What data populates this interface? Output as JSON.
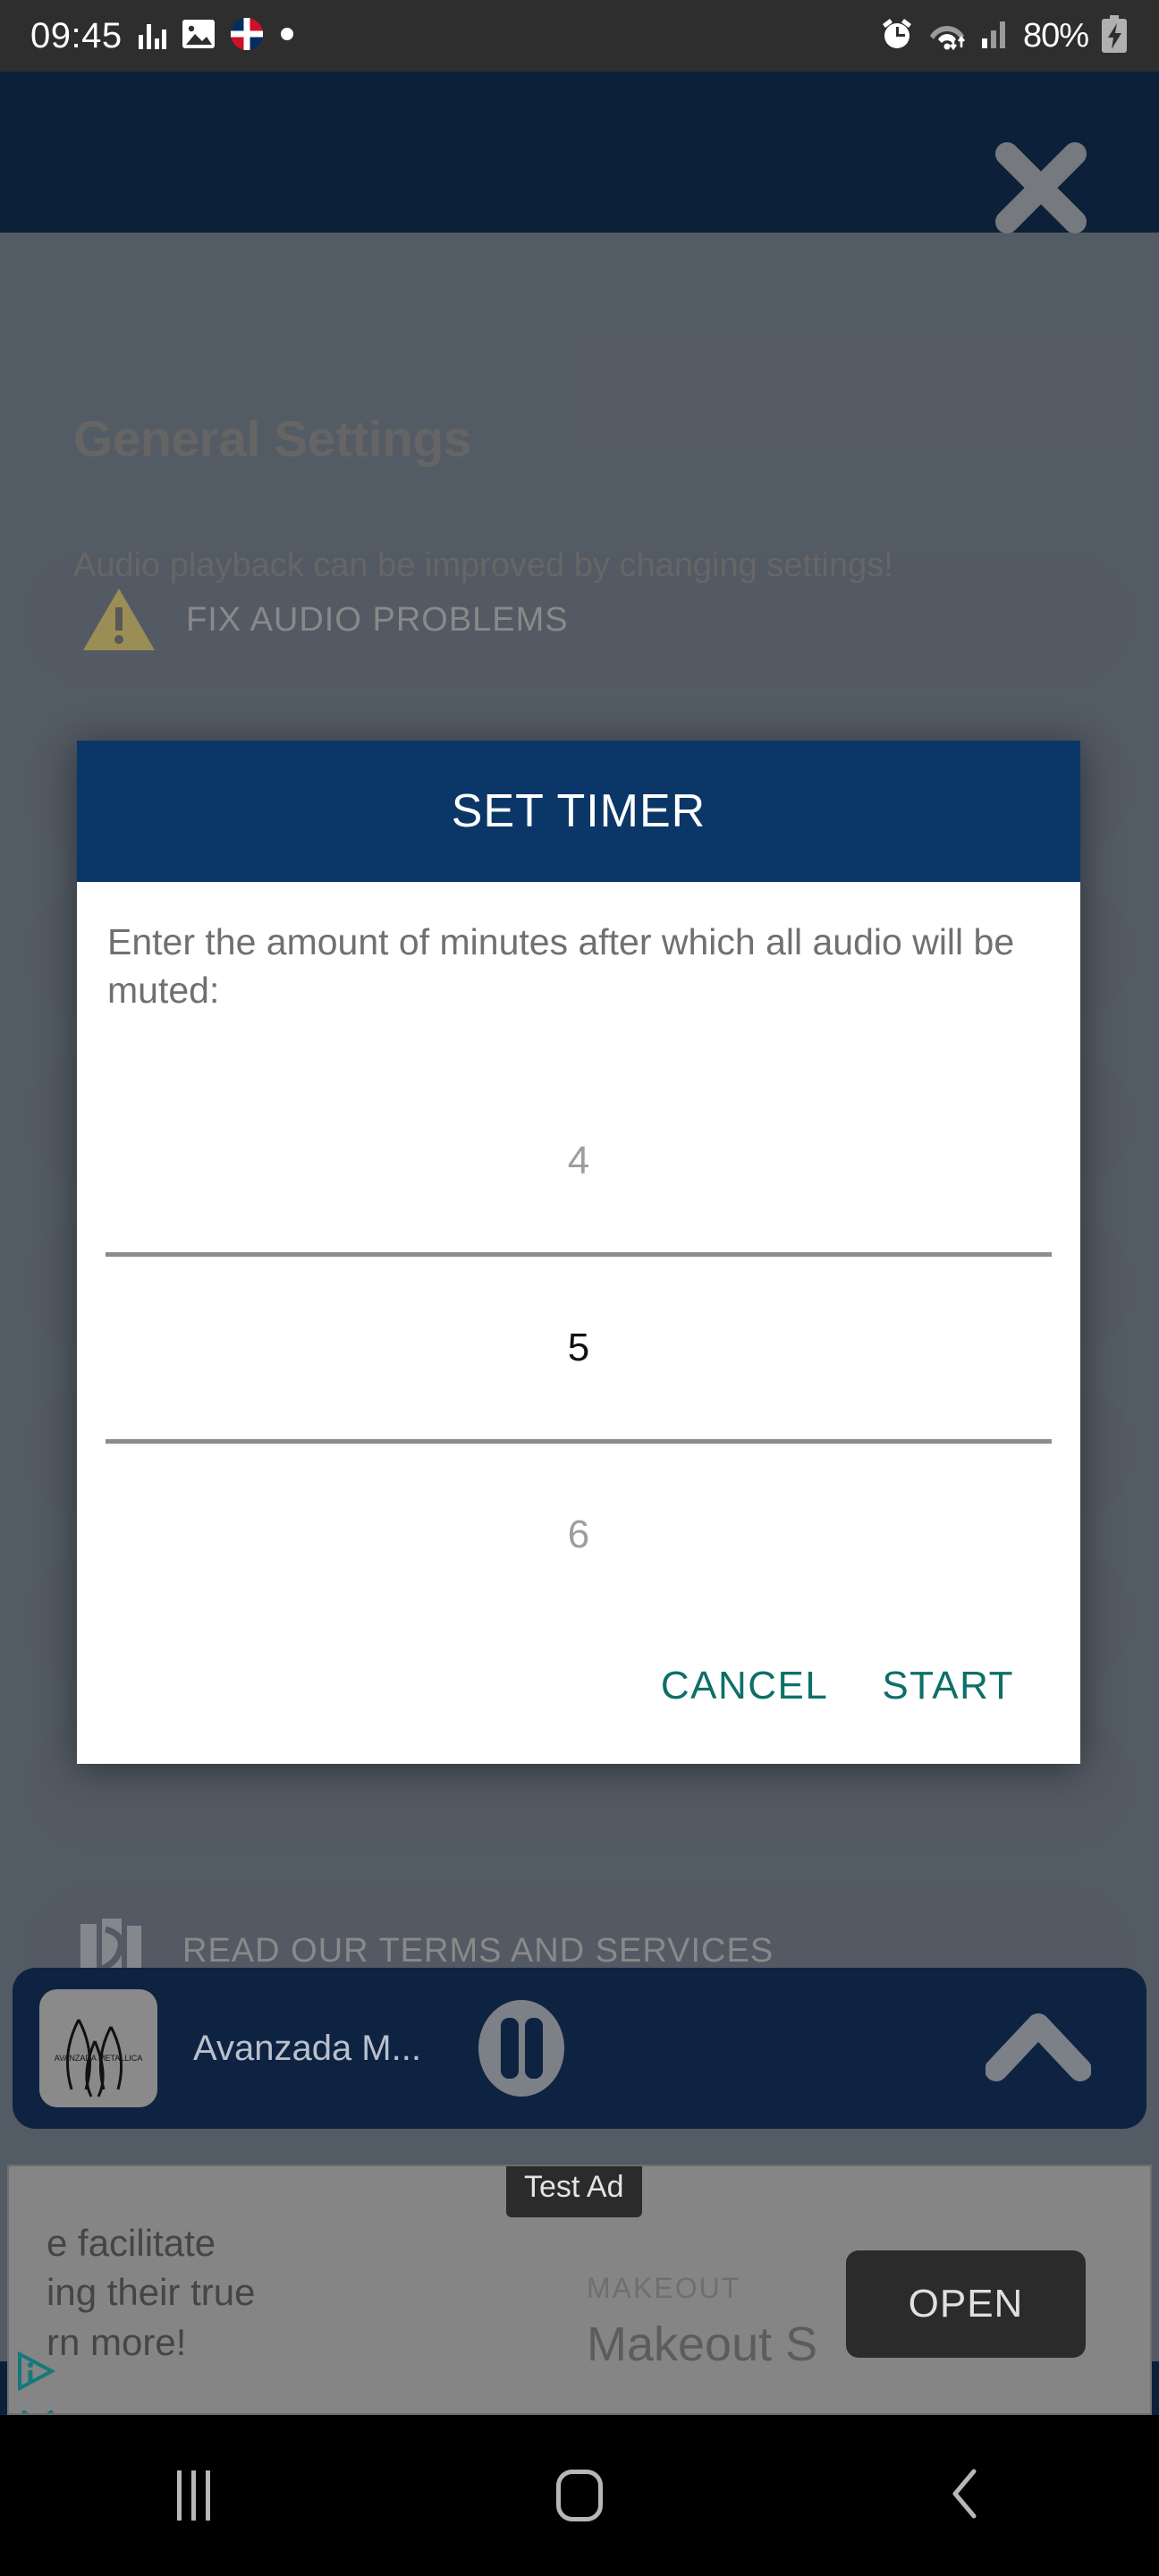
{
  "status_bar": {
    "time": "09:45",
    "battery_percent": "80%",
    "icons": [
      "equalizer-icon",
      "image-icon",
      "flag-icon",
      "dot-icon",
      "alarm-icon",
      "wifi-icon",
      "signal-icon",
      "battery-charging-icon"
    ]
  },
  "background_app": {
    "title": "General Settings",
    "subtitle": "Audio playback can be improved by changing settings!",
    "fix_audio_label": "FIX AUDIO PROBLEMS",
    "terms_label": "READ OUR TERMS AND SERVICES",
    "close_icon": "close-icon"
  },
  "dialog": {
    "title": "SET TIMER",
    "prompt": "Enter the amount of minutes after which all audio will be muted:",
    "picker": {
      "previous": "4",
      "selected": "5",
      "next": "6"
    },
    "cancel_label": "CANCEL",
    "start_label": "START",
    "header_color": "#0b3668",
    "accent_color": "#0d7068"
  },
  "player": {
    "track_title": "Avanzada M...",
    "album_art_label": "AVANZADA METALLICA",
    "pause_icon": "pause-icon",
    "expand_icon": "chevron-up-icon"
  },
  "ad": {
    "badge": "Test Ad",
    "body_text": "e facilitate\ning their true\nrn more!",
    "eyebrow": "MAKEOUT",
    "title": "Makeout S",
    "open_label": "OPEN",
    "adchoices_icon": "adchoices-info-icon",
    "close_icon": "ad-close-icon"
  },
  "nav_bar": {
    "recents_icon": "recents-icon",
    "home_icon": "home-icon",
    "back_icon": "back-icon"
  }
}
